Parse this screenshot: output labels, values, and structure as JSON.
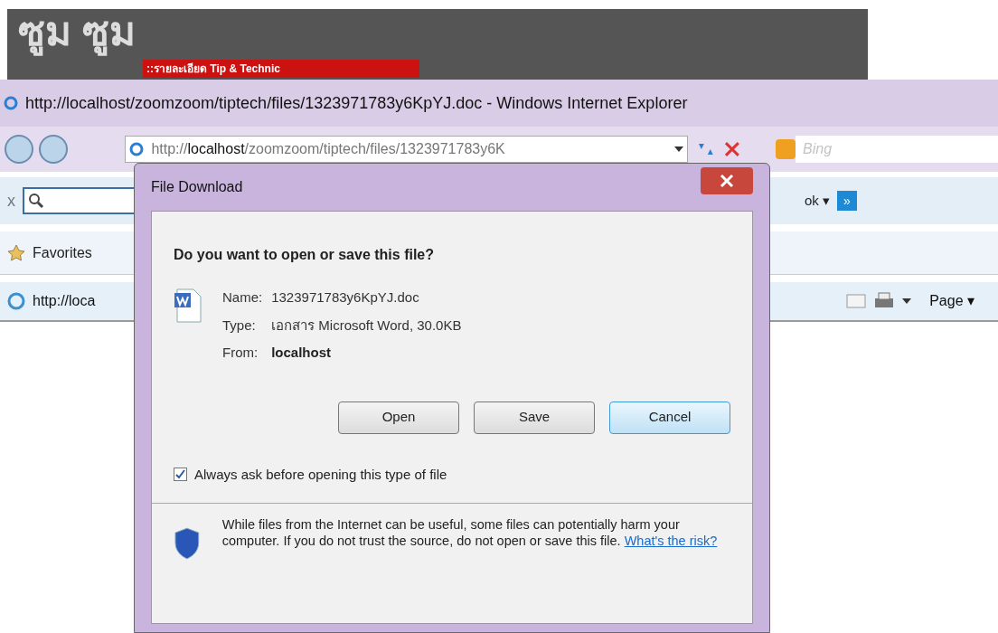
{
  "banner": {
    "logo": "ซูม ซูม",
    "caption": "::รายละเอียด Tip & Technic"
  },
  "window": {
    "title": "http://localhost/zoomzoom/tiptech/files/1323971783y6KpYJ.doc - Windows Internet Explorer"
  },
  "address_bar": {
    "prefix": "http://",
    "host": "localhost",
    "rest": "/zoomzoom/tiptech/files/1323971783y6K"
  },
  "search_box": {
    "placeholder": "Bing"
  },
  "command_bar": {
    "close_glyph": "x",
    "partial_menu": "ok ▾",
    "more_glyph": "»"
  },
  "favorites_bar": {
    "label": "Favorites"
  },
  "tab": {
    "label": "http://loca"
  },
  "toolbar": {
    "page_menu": "Page ▾"
  },
  "dialog": {
    "title": "File Download",
    "heading": "Do you want to open or save this file?",
    "fields": [
      {
        "label": "Name:",
        "value": "1323971783y6KpYJ.doc",
        "bold": false
      },
      {
        "label": "Type:",
        "value": "เอกสาร Microsoft Word, 30.0KB",
        "bold": false
      },
      {
        "label": "From:",
        "value": "localhost",
        "bold": true
      }
    ],
    "buttons": [
      {
        "label": "Open",
        "default": false
      },
      {
        "label": "Save",
        "default": false
      },
      {
        "label": "Cancel",
        "default": true
      }
    ],
    "checkbox": {
      "label": "Always ask before opening this type of file",
      "checked": true
    },
    "warning": "While files from the Internet can be useful, some files can potentially harm your computer. If you do not trust the source, do not open or save this file.",
    "risk_link": "What's the risk?"
  }
}
